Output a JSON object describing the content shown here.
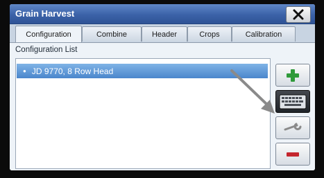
{
  "window": {
    "title": "Grain Harvest",
    "close_icon": "close-icon"
  },
  "tabs": [
    {
      "label": "Configuration",
      "active": true
    },
    {
      "label": "Combine",
      "active": false
    },
    {
      "label": "Header",
      "active": false
    },
    {
      "label": "Crops",
      "active": false
    },
    {
      "label": "Calibration",
      "active": false
    }
  ],
  "configuration_list": {
    "label": "Configuration List",
    "items": [
      {
        "label": "JD 9770, 8 Row Head",
        "selected": true
      }
    ]
  },
  "side_buttons": [
    {
      "icon": "plus-icon",
      "color": "#2f9a3a"
    },
    {
      "icon": "keyboard-icon",
      "color": "#2b2f35"
    },
    {
      "icon": "wrench-icon",
      "color": "#8a8a8a"
    },
    {
      "icon": "minus-icon",
      "color": "#c4262e"
    }
  ],
  "colors": {
    "titlebar": "#3b62a8",
    "selection": "#4a86cc",
    "annotation_arrow": "#8a8a8a"
  }
}
